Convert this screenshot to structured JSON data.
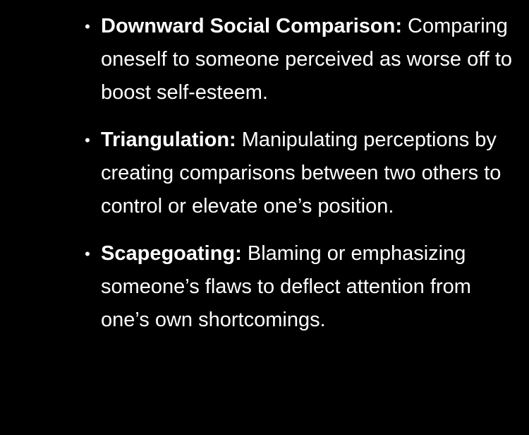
{
  "items": [
    {
      "term": "Downward Social Comparison:",
      "description": " Comparing oneself to someone perceived as worse off to boost self-esteem."
    },
    {
      "term": "Triangulation:",
      "description": " Manipulating perceptions by creating comparisons between two others to control or elevate one’s position."
    },
    {
      "term": "Scapegoating:",
      "description": " Blaming or emphasizing someone’s flaws to deflect attention from one’s own shortcomings."
    }
  ],
  "bullet_glyph": "•",
  "colors": {
    "background": "#000000",
    "text": "#ffffff"
  }
}
